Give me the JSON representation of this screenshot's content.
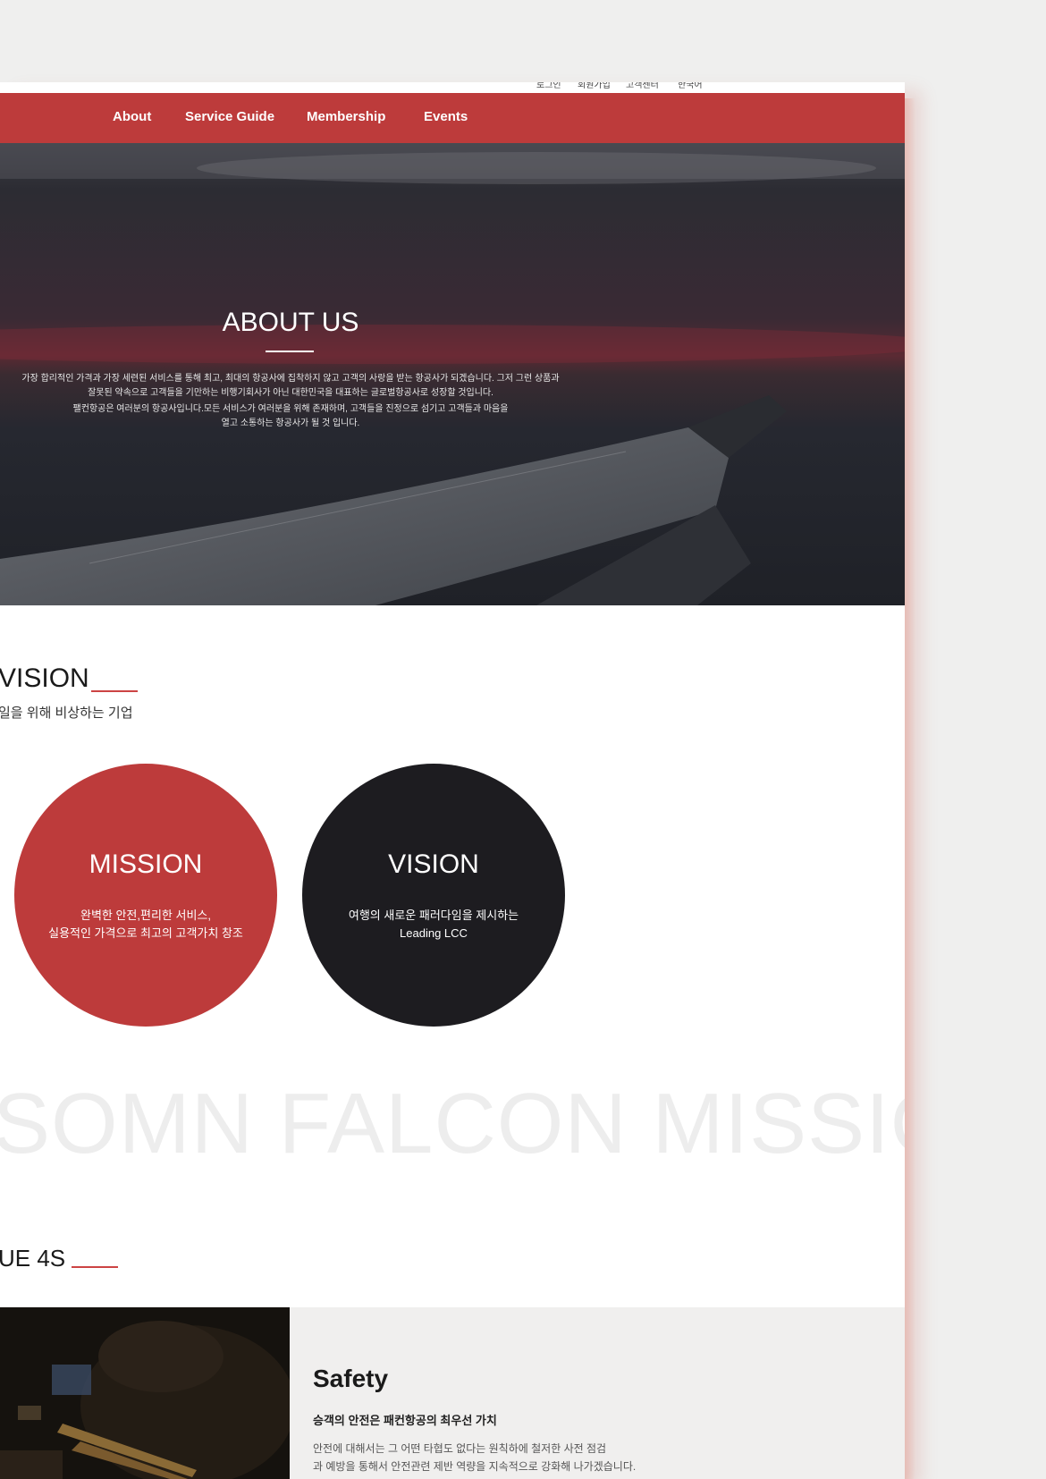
{
  "util_links": [
    "로그인",
    "회원가입",
    "고객센터",
    "한국어"
  ],
  "nav": {
    "items": [
      "About",
      "Service Guide",
      "Membership",
      "Events"
    ]
  },
  "hero": {
    "title": "ABOUT US",
    "para1": "가장 합리적인 가격과 가장 세련된 서비스를 통해 최고, 최대의 항공사에 집착하지 않고 고객의 사랑을 받는 항공사가 되겠습니다. 그저 그런 상품과 잘못된 약속으로 고객들을 기만하는 비행기회사가 아닌 대한민국을 대표하는 글로벌항공사로 성장할 것입니다.",
    "para2": "팰컨항공은 여러분의 항공사입니다.모든 서비스가 여러분을 위해 존재하며, 고객들을 진정으로 섬기고 고객들과 마음을 열고 소통하는 항공사가 될 것 입니다."
  },
  "vision_section": {
    "title": "VISION",
    "subtitle": "일을 위해 비상하는 기업"
  },
  "cards": {
    "mission": {
      "title": "MISSION",
      "line1": "완벽한 안전,편리한 서비스,",
      "line2": "실용적인 가격으로 최고의 고객가치 창조"
    },
    "vision": {
      "title": "VISION",
      "line1": "여행의 새로운 패러다임을 제시하는",
      "line2": "Leading LCC"
    }
  },
  "watermark": "SOMN FALCON MISSION",
  "values_section": {
    "title": "UE 4S"
  },
  "safety": {
    "title": "Safety",
    "subtitle": "승객의 안전은 패컨항공의 최우선 가치",
    "line1": "안전에 대해서는 그 어떤 타협도 없다는 원칙하에 철저한 사전 점검",
    "line2": "과 예방을 통해서 안전관련 제반 역량을 지속적으로 강화해 나가겠습니다."
  },
  "colors": {
    "brand_red": "#bd3b3b",
    "dark": "#1d1c20"
  }
}
